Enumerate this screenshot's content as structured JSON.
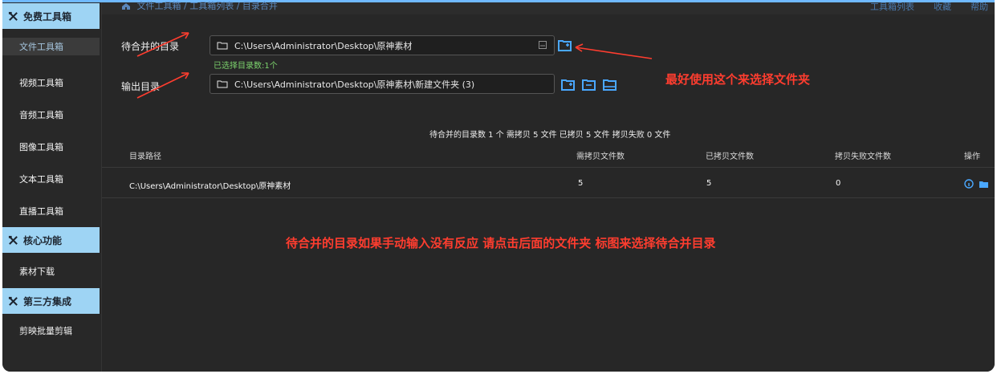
{
  "topbar": {
    "breadcrumb": "文件工具箱 / 工具箱列表 / 目录合并",
    "actions": [
      "工具箱列表",
      "收藏",
      "帮助"
    ]
  },
  "sidebar": {
    "groups": [
      {
        "label": "免费工具箱",
        "items": [
          "文件工具箱",
          "视频工具箱",
          "音频工具箱",
          "图像工具箱",
          "文本工具箱",
          "直播工具箱"
        ]
      },
      {
        "label": "核心功能",
        "items": [
          "素材下载"
        ]
      },
      {
        "label": "第三方集成",
        "items": [
          "剪映批量剪辑"
        ]
      }
    ]
  },
  "form": {
    "source_label": "待合并的目录",
    "source_path": "C:\\Users\\Administrator\\Desktop\\原神素材",
    "source_hint": "已选择目录数:1个",
    "output_label": "输出目录",
    "output_path": "C:\\Users\\Administrator\\Desktop\\原神素材\\新建文件夹 (3)"
  },
  "summary": "待合并的目录数 1 个  需拷贝 5 文件  已拷贝 5 文件  拷贝失败 0 文件",
  "table": {
    "headers": [
      "目录路径",
      "需拷贝文件数",
      "已拷贝文件数",
      "拷贝失败文件数",
      "操作"
    ],
    "rows": [
      {
        "path": "C:\\Users\\Administrator\\Desktop\\原神素材",
        "need": "5",
        "done": "5",
        "failed": "0"
      }
    ]
  },
  "annotations": {
    "top_right": "最好使用这个来选择文件夹",
    "bottom": "待合并的目录如果手动输入没有反应 请点击后面的文件夹 标图来选择待合并目录"
  },
  "colors": {
    "accent": "#58a6ff",
    "group_bg": "#9ed4f4",
    "annotation": "#ff3d2f",
    "hint": "#7cd36d"
  },
  "icons": [
    "home-icon",
    "tool-icon",
    "folder-icon",
    "paste-icon",
    "folder-open-icon",
    "info-icon"
  ]
}
